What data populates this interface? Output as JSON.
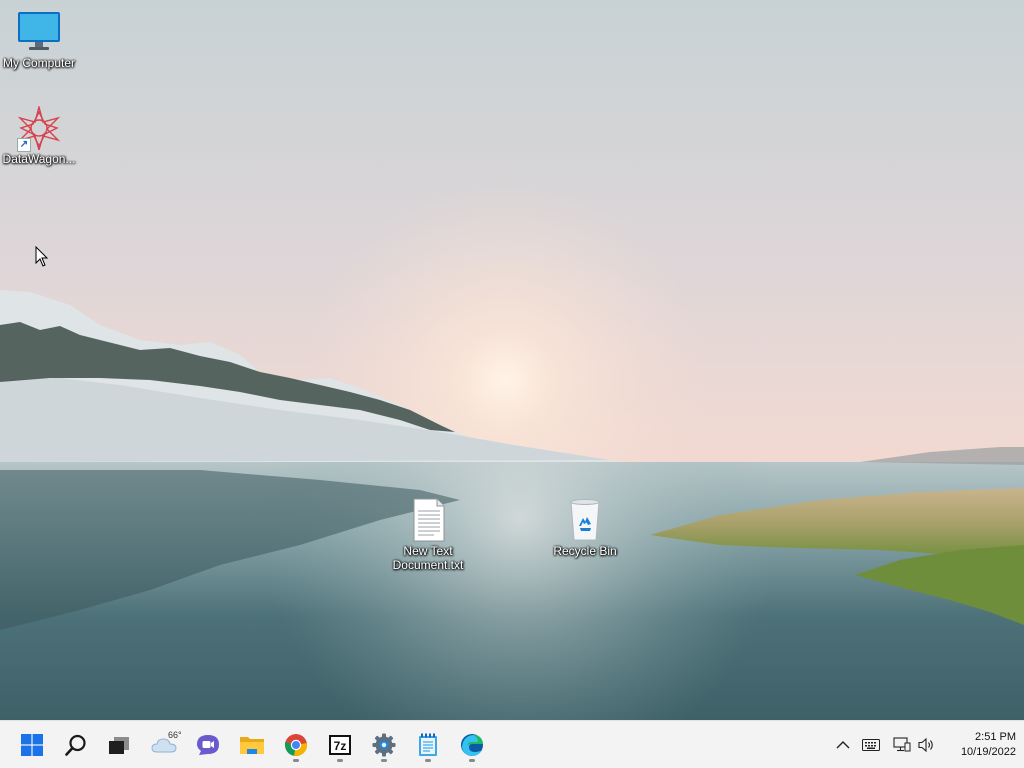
{
  "desktop": {
    "icons": [
      {
        "label": "My Computer"
      },
      {
        "label": "DataWagon..."
      },
      {
        "label": "New Text Document.txt"
      },
      {
        "label": "Recycle Bin"
      }
    ]
  },
  "taskbar": {
    "buttons": [
      {
        "icon": "windows-start-icon"
      },
      {
        "icon": "search-icon"
      },
      {
        "icon": "task-view-icon"
      },
      {
        "icon": "weather-widget-icon"
      },
      {
        "icon": "chat-icon"
      },
      {
        "icon": "file-explorer-icon"
      },
      {
        "icon": "chrome-icon"
      },
      {
        "icon": "7zip-icon"
      },
      {
        "icon": "settings-icon"
      },
      {
        "icon": "notepad-icon"
      },
      {
        "icon": "edge-icon"
      }
    ],
    "weather": {
      "temp": "66°"
    },
    "sevenzip_label": "7z",
    "tray": {
      "icons": [
        "chevron-up-icon",
        "keyboard-icon",
        "network-icon",
        "volume-icon"
      ],
      "time": "2:51 PM",
      "date": "10/19/2022"
    }
  },
  "colors": {
    "taskbar_bg": "#f3f3f3",
    "windows_blue": "#1a73e8",
    "sky_top": "#c9d3d6",
    "sky_glow": "#f2d7cf",
    "water": "#5c7f86"
  }
}
